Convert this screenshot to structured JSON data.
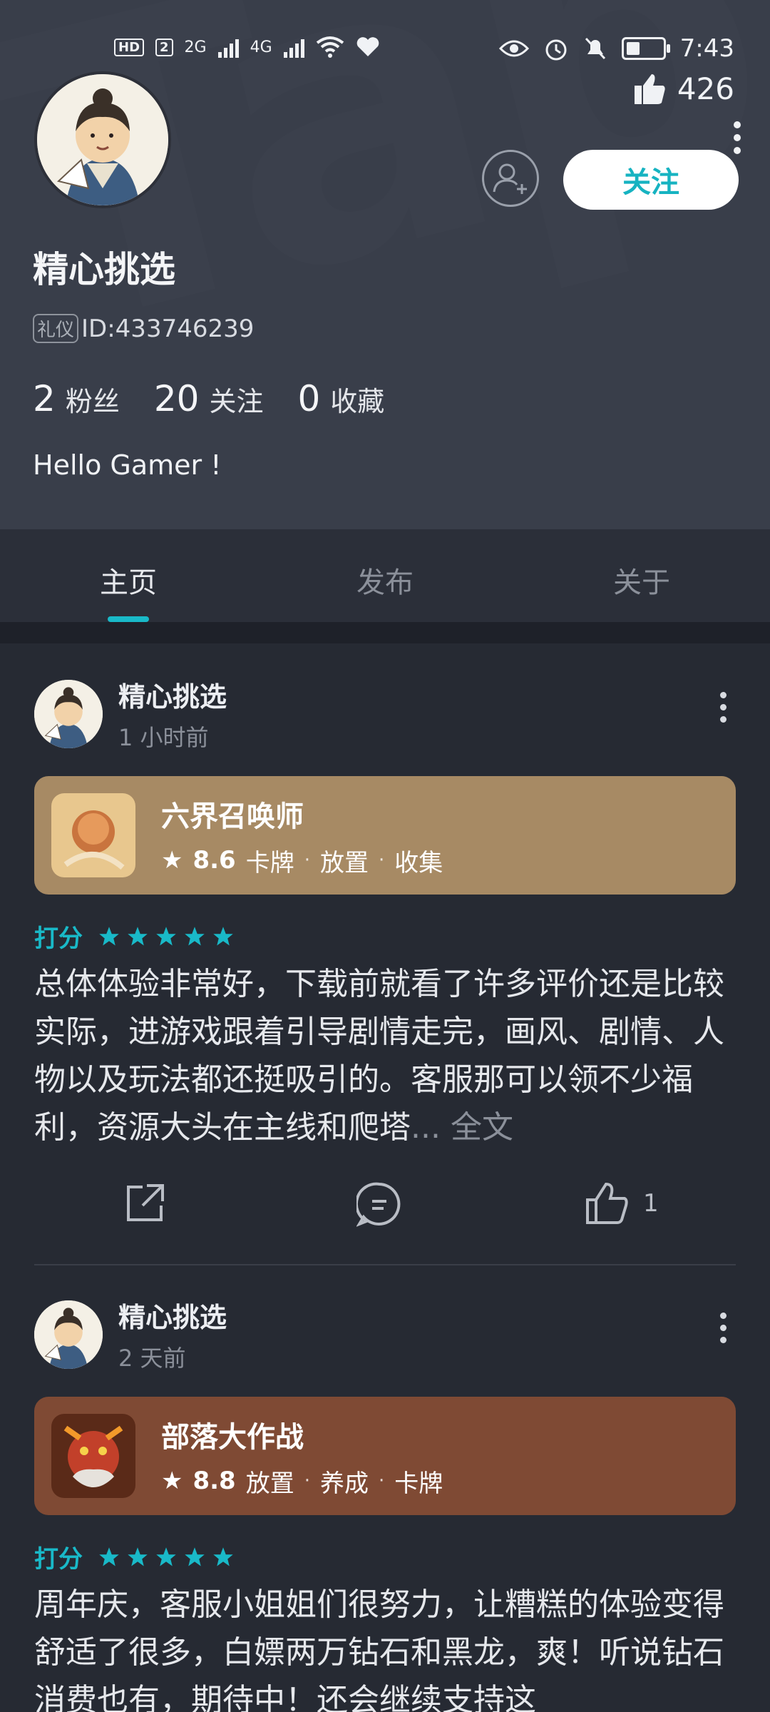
{
  "status_bar": {
    "left_chips": [
      "HD",
      "2",
      "2G",
      "4G"
    ],
    "time": "7:43"
  },
  "profile": {
    "likes": "426",
    "follow_label": "关注",
    "name": "精心挑选",
    "id_badge": "礼仪",
    "id_text": "ID:433746239",
    "stats": [
      {
        "num": "2",
        "label": "粉丝"
      },
      {
        "num": "20",
        "label": "关注"
      },
      {
        "num": "0",
        "label": "收藏"
      }
    ],
    "bio": "Hello Gamer !"
  },
  "tabs": [
    {
      "label": "主页",
      "active": true
    },
    {
      "label": "发布",
      "active": false
    },
    {
      "label": "关于",
      "active": false
    }
  ],
  "posts": [
    {
      "author": "精心挑选",
      "time": "1 小时前",
      "game": {
        "name": "六界召唤师",
        "score": "8.6",
        "tags": [
          "卡牌",
          "放置",
          "收集"
        ],
        "color": "#a78a64"
      },
      "rating_label": "打分",
      "stars": 5,
      "text": "总体体验非常好，下载前就看了许多评价还是比较实际，进游戏跟着引导剧情走完，画风、剧情、人物以及玩法都还挺吸引的。客服那可以领不少福利，资源大头在主线和爬塔",
      "more_label": "... 全文",
      "like_count": "1"
    },
    {
      "author": "精心挑选",
      "time": "2 天前",
      "game": {
        "name": "部落大作战",
        "score": "8.8",
        "tags": [
          "放置",
          "养成",
          "卡牌"
        ],
        "color": "#7f4a34"
      },
      "rating_label": "打分",
      "stars": 5,
      "text": "周年庆，客服小姐姐们很努力，让糟糕的体验变得舒适了很多，白嫖两万钻石和黑龙，爽！听说钻石消费也有，期待中！还会继续支持这"
    }
  ]
}
